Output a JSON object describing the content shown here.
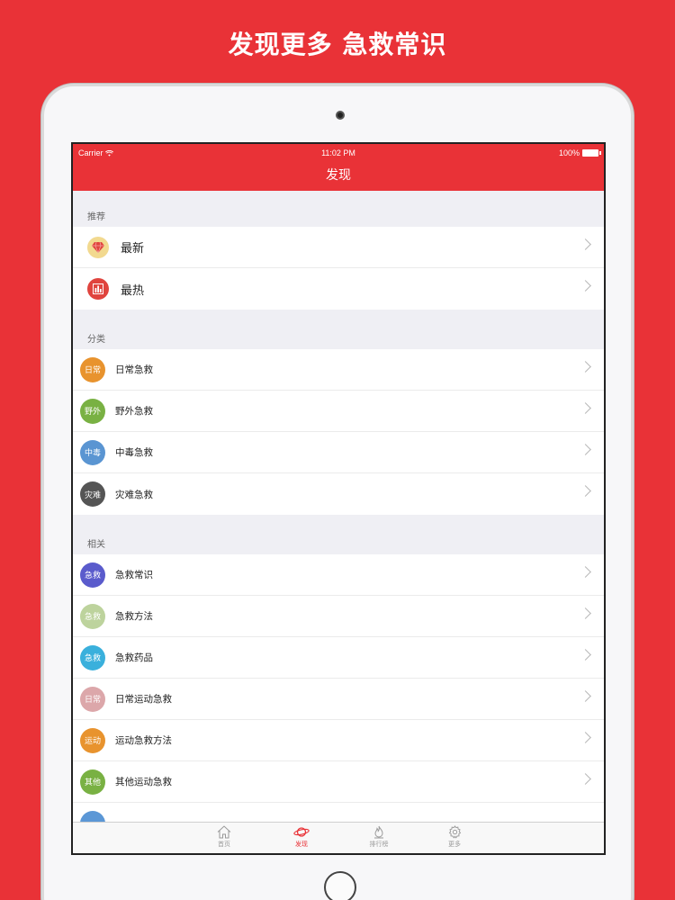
{
  "promo_title": "发现更多 急救常识",
  "status_bar": {
    "carrier": "Carrier",
    "time": "11:02 PM",
    "battery": "100%"
  },
  "nav_title": "发现",
  "sections": {
    "recommend": {
      "header": "推荐",
      "items": [
        {
          "label": "最新",
          "icon": "gem-icon",
          "color": "#f2d98f"
        },
        {
          "label": "最热",
          "icon": "bar-chart-icon",
          "color": "#e0443e"
        }
      ]
    },
    "category": {
      "header": "分类",
      "items": [
        {
          "badge": "日常",
          "label": "日常急救",
          "color": "#e8932e"
        },
        {
          "badge": "野外",
          "label": "野外急救",
          "color": "#79b143"
        },
        {
          "badge": "中毒",
          "label": "中毒急救",
          "color": "#5a95d2"
        },
        {
          "badge": "灾难",
          "label": "灾难急救",
          "color": "#555555"
        }
      ]
    },
    "related": {
      "header": "相关",
      "items": [
        {
          "badge": "急救",
          "label": "急救常识",
          "color": "#5a5bcc"
        },
        {
          "badge": "急救",
          "label": "急救方法",
          "color": "#bdd39d"
        },
        {
          "badge": "急救",
          "label": "急救药品",
          "color": "#3ab0dc"
        },
        {
          "badge": "日常",
          "label": "日常运动急救",
          "color": "#dca7aa"
        },
        {
          "badge": "运动",
          "label": "运动急救方法",
          "color": "#e8932e"
        },
        {
          "badge": "其他",
          "label": "其他运动急救",
          "color": "#79b143"
        }
      ]
    }
  },
  "tabbar": [
    {
      "label": "首页",
      "icon": "home-icon",
      "active": false
    },
    {
      "label": "发现",
      "icon": "planet-icon",
      "active": true
    },
    {
      "label": "排行榜",
      "icon": "flame-icon",
      "active": false
    },
    {
      "label": "更多",
      "icon": "gear-icon",
      "active": false
    }
  ],
  "colors": {
    "brand_red": "#e93237"
  }
}
